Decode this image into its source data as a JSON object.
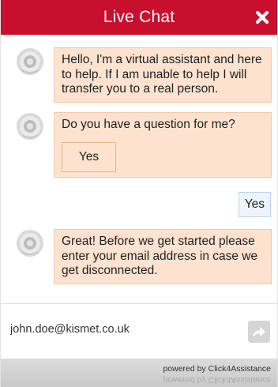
{
  "header": {
    "title": "Live Chat",
    "close_icon": "close-icon"
  },
  "messages": [
    {
      "sender": "agent",
      "avatar_icon": "agent-avatar-icon",
      "text": "Hello, I'm a virtual assistant and here to help. If I am unable to help I will transfer you to a real person."
    },
    {
      "sender": "agent",
      "avatar_icon": "agent-avatar-icon",
      "text": "Do you have a question for me?",
      "button_label": "Yes"
    },
    {
      "sender": "user",
      "text": "Yes"
    },
    {
      "sender": "agent",
      "avatar_icon": "agent-avatar-icon",
      "text": "Great! Before we get started please enter your email address in case we get disconnected."
    }
  ],
  "input": {
    "value": "john.doe@kismet.co.uk",
    "send_icon": "send-arrow-icon"
  },
  "footer": {
    "powered_by": "powered by Click4Assistance"
  },
  "colors": {
    "header_bg": "#c8102e",
    "agent_bubble_bg": "#fde3cf",
    "agent_bubble_border": "#f5c7a4",
    "user_bubble_bg": "#eef4fb",
    "user_bubble_border": "#bcd3ec",
    "footer_bg": "#d3d3d3"
  }
}
